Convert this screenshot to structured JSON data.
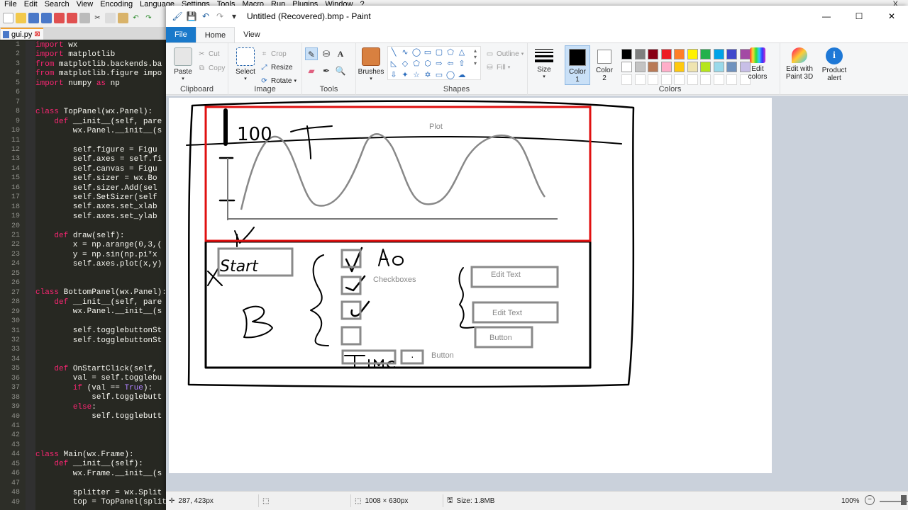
{
  "npp": {
    "menu": [
      "File",
      "Edit",
      "Search",
      "View",
      "Encoding",
      "Language",
      "Settings",
      "Tools",
      "Macro",
      "Run",
      "Plugins",
      "Window",
      "?"
    ],
    "close": "X",
    "tab_label": "gui.py",
    "lines": [
      {
        "n": "1",
        "t": "import wx"
      },
      {
        "n": "2",
        "t": "import matplotlib"
      },
      {
        "n": "3",
        "t": "from matplotlib.backends.ba"
      },
      {
        "n": "4",
        "t": "from matplotlib.figure impo"
      },
      {
        "n": "5",
        "t": "import numpy as np"
      },
      {
        "n": "6",
        "t": ""
      },
      {
        "n": "7",
        "t": ""
      },
      {
        "n": "8",
        "t": "class TopPanel(wx.Panel):"
      },
      {
        "n": "9",
        "t": "    def __init__(self, pare"
      },
      {
        "n": "10",
        "t": "        wx.Panel.__init__(s"
      },
      {
        "n": "11",
        "t": ""
      },
      {
        "n": "12",
        "t": "        self.figure = Figu"
      },
      {
        "n": "13",
        "t": "        self.axes = self.fi"
      },
      {
        "n": "14",
        "t": "        self.canvas = Figu"
      },
      {
        "n": "15",
        "t": "        self.sizer = wx.Bo"
      },
      {
        "n": "16",
        "t": "        self.sizer.Add(sel"
      },
      {
        "n": "17",
        "t": "        self.SetSizer(self"
      },
      {
        "n": "18",
        "t": "        self.axes.set_xlab"
      },
      {
        "n": "19",
        "t": "        self.axes.set_ylab"
      },
      {
        "n": "20",
        "t": ""
      },
      {
        "n": "21",
        "t": "    def draw(self):"
      },
      {
        "n": "22",
        "t": "        x = np.arange(0,3,("
      },
      {
        "n": "23",
        "t": "        y = np.sin(np.pi*x"
      },
      {
        "n": "24",
        "t": "        self.axes.plot(x,y)"
      },
      {
        "n": "25",
        "t": ""
      },
      {
        "n": "26",
        "t": ""
      },
      {
        "n": "27",
        "t": "class BottomPanel(wx.Panel):"
      },
      {
        "n": "28",
        "t": "    def __init__(self, pare"
      },
      {
        "n": "29",
        "t": "        wx.Panel.__init__(s"
      },
      {
        "n": "30",
        "t": ""
      },
      {
        "n": "31",
        "t": "        self.togglebuttonSt"
      },
      {
        "n": "32",
        "t": "        self.togglebuttonSt"
      },
      {
        "n": "33",
        "t": ""
      },
      {
        "n": "34",
        "t": ""
      },
      {
        "n": "35",
        "t": "    def OnStartClick(self, "
      },
      {
        "n": "36",
        "t": "        val = self.togglebu"
      },
      {
        "n": "37",
        "t": "        if (val == True):"
      },
      {
        "n": "38",
        "t": "            self.togglebutt"
      },
      {
        "n": "39",
        "t": "        else:"
      },
      {
        "n": "40",
        "t": "            self.togglebutt"
      },
      {
        "n": "41",
        "t": ""
      },
      {
        "n": "42",
        "t": ""
      },
      {
        "n": "43",
        "t": ""
      },
      {
        "n": "44",
        "t": "class Main(wx.Frame):"
      },
      {
        "n": "45",
        "t": "    def __init__(self):"
      },
      {
        "n": "46",
        "t": "        wx.Frame.__init__(s"
      },
      {
        "n": "47",
        "t": ""
      },
      {
        "n": "48",
        "t": "        splitter = wx.Split"
      },
      {
        "n": "49",
        "t": "        top = TopPanel(splitter)"
      }
    ]
  },
  "paint": {
    "title": "Untitled (Recovered).bmp - Paint",
    "window_buttons": [
      "—",
      "☐",
      "✕"
    ],
    "tabs": {
      "file": "File",
      "home": "Home",
      "view": "View"
    },
    "clipboard": {
      "label": "Clipboard",
      "paste": "Paste",
      "cut": "Cut",
      "copy": "Copy"
    },
    "image": {
      "label": "Image",
      "select": "Select",
      "crop": "Crop",
      "resize": "Resize",
      "rotate": "Rotate"
    },
    "tools": {
      "label": "Tools"
    },
    "shapes": {
      "label": "Shapes",
      "outline": "Outline",
      "fill": "Fill"
    },
    "brushes": "Brushes",
    "size": "Size",
    "colors": {
      "label": "Colors",
      "color1": "Color",
      "color1_n": "1",
      "color2": "Color",
      "color2_n": "2",
      "edit": "Edit",
      "edit2": "colors",
      "palette": [
        "#000000",
        "#7f7f7f",
        "#880015",
        "#ed1c24",
        "#ff7f27",
        "#fff200",
        "#22b14c",
        "#00a2e8",
        "#3f48cc",
        "#a349a4",
        "#ffffff",
        "#c3c3c3",
        "#b97a57",
        "#ffaec9",
        "#ffc90e",
        "#efe4b0",
        "#b5e61d",
        "#99d9ea",
        "#7092be",
        "#c8bfe7"
      ],
      "color1_value": "#000000",
      "color2_value": "#ffffff"
    },
    "edit_3d": {
      "l1": "Edit with",
      "l2": "Paint 3D"
    },
    "product_alert": {
      "l1": "Product",
      "l2": "alert"
    },
    "drawing": {
      "plot": "Plot",
      "y_top": "100",
      "checkboxes": "Checkboxes",
      "edit_text_1": "Edit Text",
      "edit_text_2": "Edit Text",
      "button_1": "Button",
      "button_2": "Button",
      "hand_start": "Start",
      "hand_ao": "Ao",
      "hand_time": "Time",
      "hand_b": "B",
      "hand_y": "Y",
      "hand_x": "X"
    },
    "status": {
      "cursor": "287, 423px",
      "dimensions": "1008 × 630px",
      "size": "Size: 1.8MB",
      "zoom": "100%"
    }
  }
}
